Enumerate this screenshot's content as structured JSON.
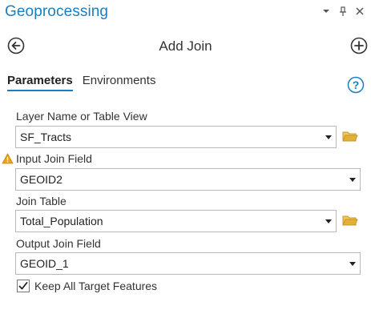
{
  "pane": {
    "title": "Geoprocessing",
    "header_icons": [
      "menu-dropdown-icon",
      "pin-icon",
      "close-icon"
    ]
  },
  "tool": {
    "title": "Add Join",
    "back_icon": "back-arrow-icon",
    "add_icon": "add-circle-icon"
  },
  "tabs": [
    {
      "label": "Parameters",
      "active": true
    },
    {
      "label": "Environments",
      "active": false
    }
  ],
  "help_icon": "help-question-icon",
  "fields": {
    "layer": {
      "label": "Layer Name or Table View",
      "value": "SF_Tracts"
    },
    "input_join": {
      "label": "Input Join Field",
      "value": "GEOID2",
      "warning": true
    },
    "join_table": {
      "label": "Join Table",
      "value": "Total_Population"
    },
    "output_join": {
      "label": "Output Join Field",
      "value": "GEOID_1"
    }
  },
  "keep_all": {
    "label": "Keep All Target Features",
    "checked": true
  },
  "colors": {
    "accent": "#1a7fc1",
    "folder": "#e0b23a",
    "warning": "#e8a317"
  }
}
